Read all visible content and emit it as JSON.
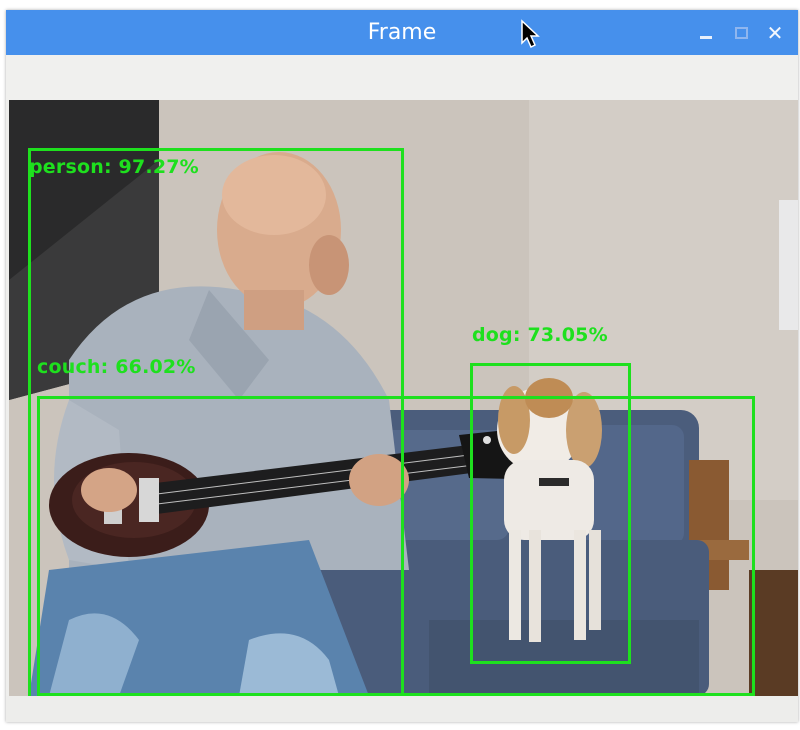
{
  "window": {
    "title": "Frame"
  },
  "controls": {
    "minimize_icon": "minimize-icon",
    "maximize_icon": "maximize-icon",
    "close_icon": "close-icon",
    "close_glyph": "✕"
  },
  "detections": [
    {
      "label": "person: 97.27%"
    },
    {
      "label": "couch: 66.02%"
    },
    {
      "label": "dog: 73.05%"
    }
  ],
  "colors": {
    "titlebar": "#4690ec",
    "detection_box": "#1ee01e",
    "window_bg": "#eeeeec"
  }
}
